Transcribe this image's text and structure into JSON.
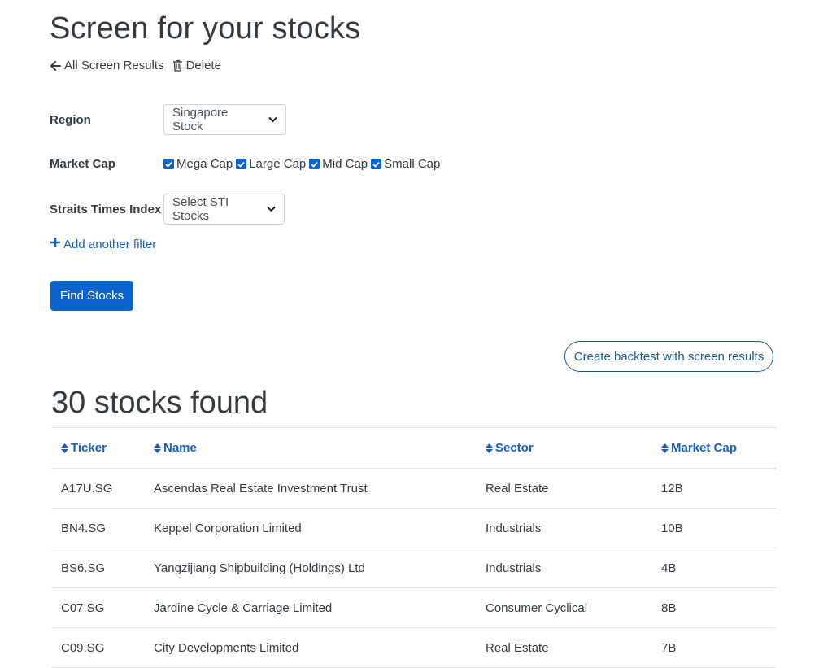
{
  "header": {
    "title": "Screen for your stocks",
    "back_label": "All Screen Results",
    "delete_label": "Delete"
  },
  "filters": {
    "region": {
      "label": "Region",
      "selected": "Singapore Stock"
    },
    "market_cap": {
      "label": "Market Cap",
      "options": [
        {
          "label": "Mega Cap",
          "checked": true
        },
        {
          "label": "Large Cap",
          "checked": true
        },
        {
          "label": "Mid Cap",
          "checked": true
        },
        {
          "label": "Small Cap",
          "checked": true
        }
      ]
    },
    "sti": {
      "label": "Straits Times Index",
      "selected": "Select STI Stocks"
    },
    "add_filter_label": "Add another filter"
  },
  "actions": {
    "find_label": "Find Stocks",
    "backtest_label": "Create backtest with screen results"
  },
  "results": {
    "title": "30 stocks found",
    "columns": [
      "Ticker",
      "Name",
      "Sector",
      "Market Cap"
    ],
    "rows": [
      [
        "A17U.SG",
        "Ascendas Real Estate Investment Trust",
        "Real Estate",
        "12B"
      ],
      [
        "BN4.SG",
        "Keppel Corporation Limited",
        "Industrials",
        "10B"
      ],
      [
        "BS6.SG",
        "Yangzijiang Shipbuilding (Holdings) Ltd",
        "Industrials",
        "4B"
      ],
      [
        "C07.SG",
        "Jardine Cycle & Carriage Limited",
        "Consumer Cyclical",
        "8B"
      ],
      [
        "C09.SG",
        "City Developments Limited",
        "Real Estate",
        "7B"
      ]
    ]
  },
  "colors": {
    "primary": "#0b63ce",
    "link": "#1c5ec0",
    "outline": "#1f5a92",
    "text": "#343a40"
  },
  "icons": {
    "back": "arrow-left-icon",
    "delete": "trash-icon",
    "add": "plus-icon",
    "sort": "sort-icon",
    "select": "chevron-down-icon",
    "checkbox": "check-icon"
  }
}
